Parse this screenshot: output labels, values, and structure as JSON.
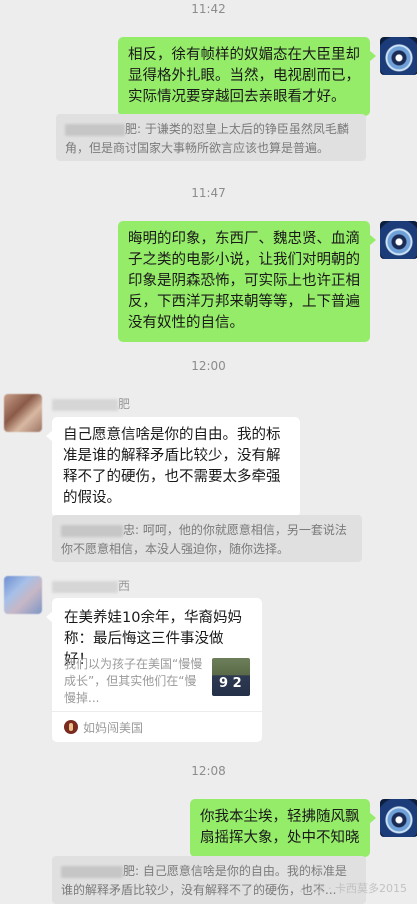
{
  "timestamps": [
    "11:42",
    "11:47",
    "12:00",
    "12:08"
  ],
  "messages": {
    "m1": "相反，徐有帧样的奴媚态在大臣里却显得格外扎眼。当然，电视剧而已，实际情况要穿越回去亲眼看才好。",
    "q1_tail": "肥: 于谦类的怼皇上太后的铮臣虽然凤毛麟角，但是商讨国家大事畅所欲言应该也算是普遍。",
    "m2": "晦明的印象，东西厂、魏忠贤、血滴子之类的电影小说，让我们对明朝的印象是阴森恐怖，可实际上也许正相反，下西洋万邦来朝等等，上下普遍没有奴性的自信。",
    "nick1_tail": "肥",
    "m3": "自己愿意信啥是你的自由。我的标准是谁的解释矛盾比较少，没有解释不了的硬伤，也不需要太多牵强的假设。",
    "q2_tail": "忠: 呵呵，他的你就愿意相信，另一套说法你不愿意相信，本没人强迫你，随你选择。",
    "nick2_tail": "西",
    "m4": "你我本尘埃，轻拂随风飘扇摇挥大象，处中不知晓",
    "q3_tail": "肥: 自己愿意信啥是你的自由。我的标准是谁的解释矛盾比较少，没有解释不了的硬伤，也不..."
  },
  "card": {
    "title": "在美养娃10余年，华裔妈妈称：最后悔这三件事没做好！",
    "desc": "我们以为孩子在美国“慢慢成长”，但其实他们在“慢慢掉...",
    "thumb_text": "9 2",
    "source": "如妈闯美国"
  },
  "watermark": "… 众 · 卡西莫多2015",
  "icons": {
    "my_avatar": "blue-eye-avatar",
    "source_icon": "red-circle-logo-icon"
  }
}
